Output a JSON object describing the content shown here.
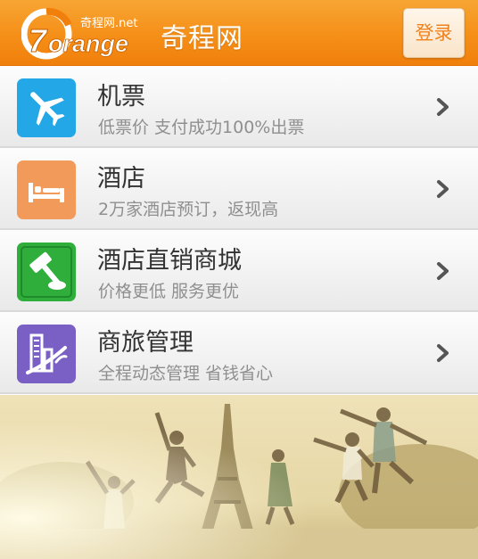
{
  "header": {
    "logo_text": "7orange",
    "logo_subtext": "奇程网.net",
    "title": "奇程网",
    "login_label": "登录",
    "accent_color": "#f58f18"
  },
  "menu": {
    "items": [
      {
        "title": "机票",
        "subtitle": "低票价 支付成功100%出票",
        "icon": "airplane-icon",
        "tile_color": "#24a7e6"
      },
      {
        "title": "酒店",
        "subtitle": "2万家酒店预订，返现高",
        "icon": "bed-icon",
        "tile_color": "#f29a59"
      },
      {
        "title": "酒店直销商城",
        "subtitle": "价格更低 服务更优",
        "icon": "gavel-icon",
        "tile_color": "#2fae3c"
      },
      {
        "title": "商旅管理",
        "subtitle": "全程动态管理 省钱省心",
        "icon": "building-icon",
        "tile_color": "#7a5fc4"
      }
    ],
    "chevron_icon": "chevron-right-icon"
  },
  "banner": {
    "image": "people-jumping-near-eiffel-tower-photo"
  }
}
